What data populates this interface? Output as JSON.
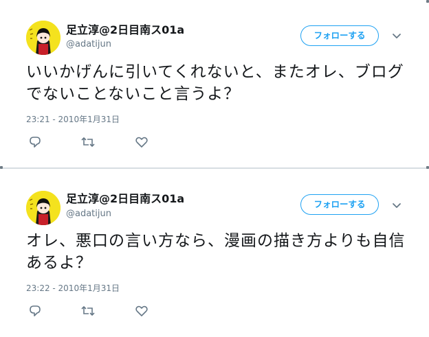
{
  "tweets": [
    {
      "display_name": "足立淳@2日目南ス01a",
      "handle": "@adatijun",
      "follow_label": "フォローする",
      "text": "いいかげんに引いてくれないと、またオレ、ブログでないことないこと言うよ？",
      "timestamp": "23:21 - 2010年1月31日",
      "icons": [
        "reply-icon",
        "retweet-icon",
        "like-icon",
        "chevron-down-icon"
      ]
    },
    {
      "display_name": "足立淳@2日目南ス01a",
      "handle": "@adatijun",
      "follow_label": "フォローする",
      "text": "オレ、悪口の言い方なら、漫画の描き方よりも自信あるよ？",
      "timestamp": "23:22 - 2010年1月31日",
      "icons": [
        "reply-icon",
        "retweet-icon",
        "like-icon",
        "chevron-down-icon"
      ]
    }
  ],
  "colors": {
    "accent": "#1da1f2",
    "secondary_text": "#657786",
    "primary_text": "#14171a",
    "avatar_bg": "#f4e21e"
  }
}
